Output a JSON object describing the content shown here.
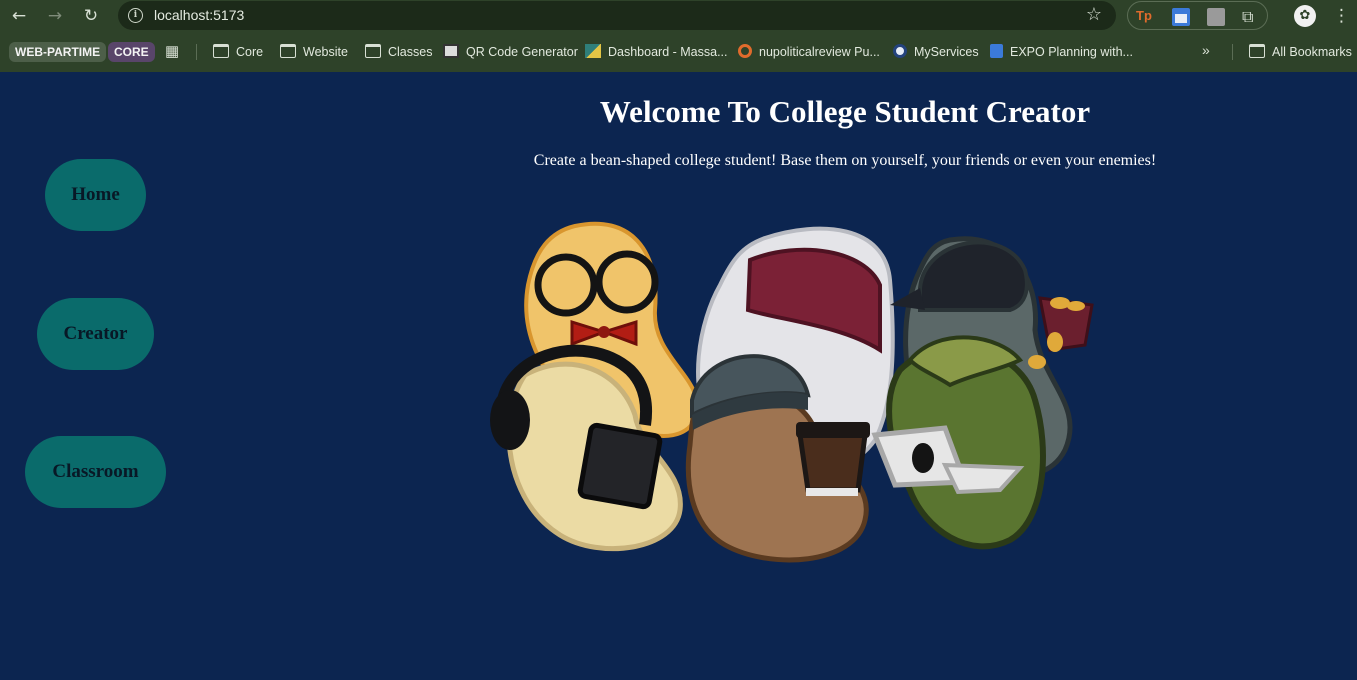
{
  "browser": {
    "url": "localhost:5173",
    "bookmarks": {
      "chips": [
        "WEB-PARTIME",
        "CORE"
      ],
      "items": [
        {
          "label": "Core",
          "icon": "folder-icon"
        },
        {
          "label": "Website",
          "icon": "folder-icon"
        },
        {
          "label": "Classes",
          "icon": "folder-icon"
        },
        {
          "label": "QR Code Generator",
          "icon": "qr-code-icon"
        },
        {
          "label": "Dashboard - Massa...",
          "icon": "dashboard-icon"
        },
        {
          "label": "nupoliticalreview Pu...",
          "icon": "nupoliticalreview-icon"
        },
        {
          "label": "MyServices",
          "icon": "myservices-icon"
        },
        {
          "label": "EXPO Planning with...",
          "icon": "docs-icon"
        }
      ],
      "all_bookmarks": "All Bookmarks"
    },
    "extensions": {
      "tp_label": "Tp"
    }
  },
  "nav": {
    "home": "Home",
    "creator": "Creator",
    "classroom": "Classroom"
  },
  "main": {
    "title": "Welcome To College Student Creator",
    "subtitle": "Create a bean-shaped college student! Base them on yourself, your friends or even your enemies!"
  },
  "colors": {
    "page_background": "#0c2550",
    "nav_button": "#0a6b6b",
    "browser_frame": "#2e4229"
  }
}
